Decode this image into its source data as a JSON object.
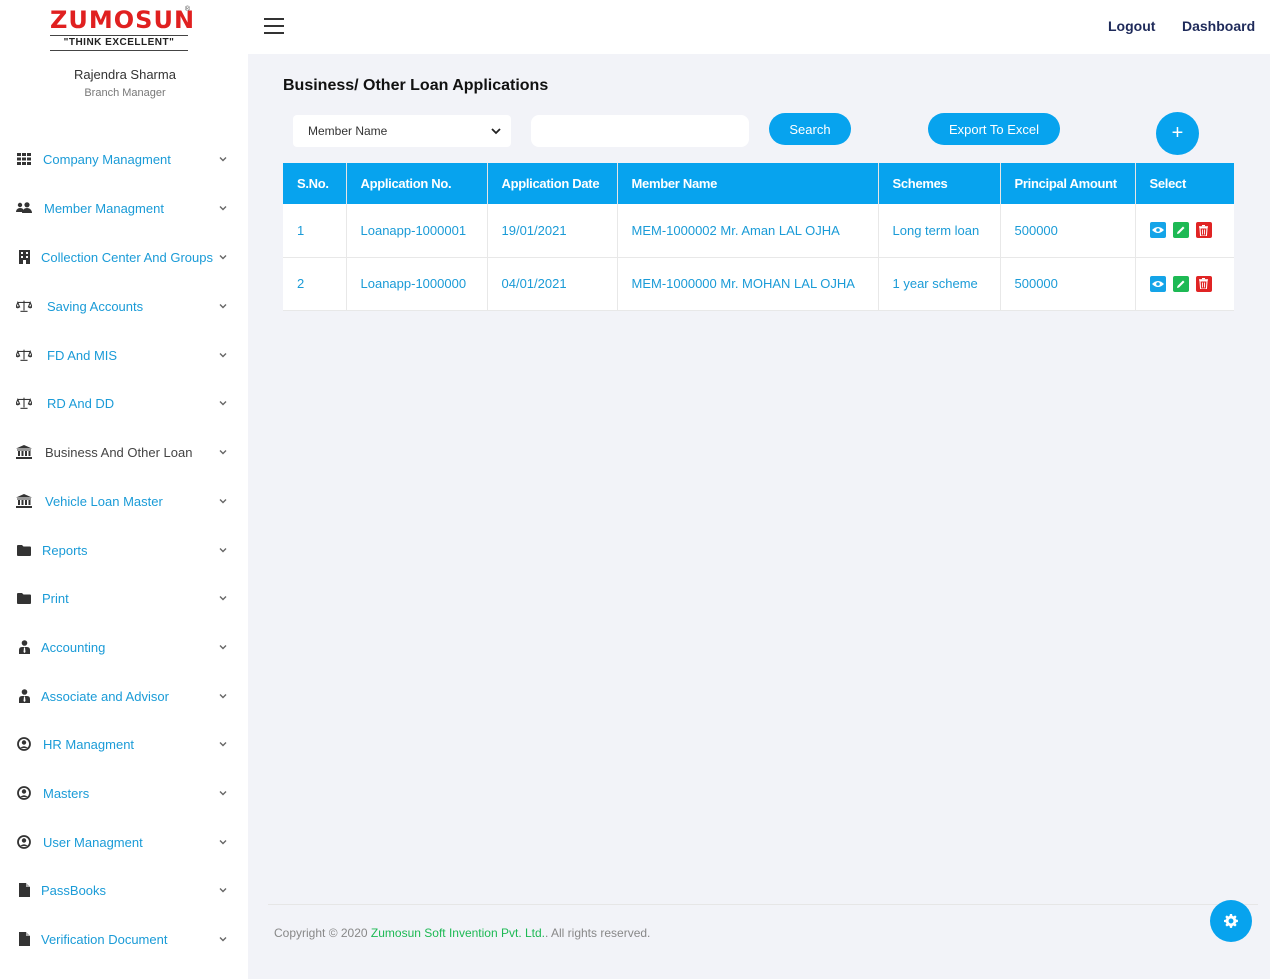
{
  "brand": {
    "logo_text": "ZUMOSUN",
    "registered": "®",
    "tagline": "\"THINK EXCELLENT\""
  },
  "user": {
    "name": "Rajendra Sharma",
    "role": "Branch Manager"
  },
  "nav": [
    {
      "label": "Company Managment",
      "icon": "grid-icon"
    },
    {
      "label": "Member Managment",
      "icon": "users-icon"
    },
    {
      "label": "Collection Center And Groups",
      "icon": "building-icon"
    },
    {
      "label": "Saving Accounts",
      "icon": "balance-scale-icon"
    },
    {
      "label": "FD And MIS",
      "icon": "balance-scale-icon"
    },
    {
      "label": "RD And DD",
      "icon": "balance-scale-icon"
    },
    {
      "label": "Business And Other Loan",
      "icon": "bank-icon"
    },
    {
      "label": "Vehicle Loan Master",
      "icon": "bank-icon"
    },
    {
      "label": "Reports",
      "icon": "folder-icon"
    },
    {
      "label": "Print",
      "icon": "folder-icon"
    },
    {
      "label": "Accounting",
      "icon": "user-tie-icon"
    },
    {
      "label": "Associate and Advisor",
      "icon": "user-tie-icon"
    },
    {
      "label": "HR Managment",
      "icon": "user-circle-icon"
    },
    {
      "label": "Masters",
      "icon": "user-circle-icon"
    },
    {
      "label": "User Managment",
      "icon": "user-circle-icon"
    },
    {
      "label": "PassBooks",
      "icon": "file-icon"
    },
    {
      "label": "Verification Document",
      "icon": "file-icon"
    }
  ],
  "topbar": {
    "logout": "Logout",
    "dashboard": "Dashboard"
  },
  "page": {
    "title": "Business/ Other Loan Applications",
    "filter_select": "Member Name",
    "search_value": "",
    "search_button": "Search",
    "export_button": "Export To Excel",
    "add_button": "+"
  },
  "table": {
    "headers": [
      "S.No.",
      "Application No.",
      "Application Date",
      "Member Name",
      "Schemes",
      "Principal Amount",
      "Select"
    ],
    "rows": [
      [
        "1",
        "Loanapp-1000001",
        "19/01/2021",
        "MEM-1000002 Mr. Aman LAL OJHA",
        "Long term loan",
        "500000"
      ],
      [
        "2",
        "Loanapp-1000000",
        "04/01/2021",
        "MEM-1000000 Mr. MOHAN LAL OJHA",
        "1 year scheme",
        "500000"
      ]
    ]
  },
  "footer": {
    "prefix": "Copyright © 2020 ",
    "company": "Zumosun Soft Invention Pvt. Ltd.",
    "suffix": ". All rights reserved."
  },
  "colors": {
    "accent": "#07a3ee",
    "link": "#1a9bd7",
    "view": "#14a4e8",
    "edit": "#1db954",
    "delete": "#e02424"
  }
}
